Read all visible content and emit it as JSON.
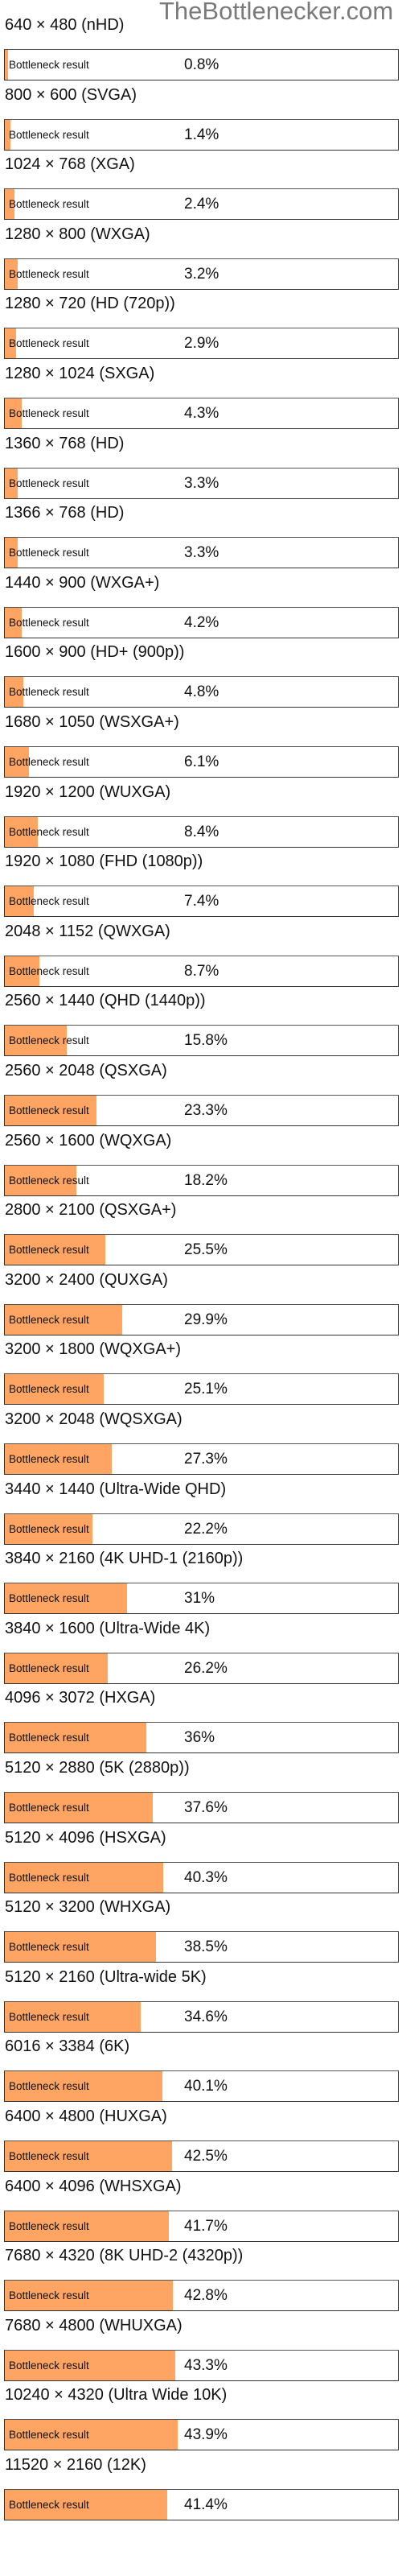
{
  "site": {
    "watermark": "TheBottlenecker.com"
  },
  "colors": {
    "fill": "#ffa563",
    "border": "#333333"
  },
  "chart_data": {
    "type": "bar",
    "title": "",
    "bar_label": "Bottleneck result",
    "xlabel": "",
    "ylabel": "Bottleneck result (%)",
    "ylim": [
      0,
      100
    ],
    "categories": [
      "640 × 480 (nHD)",
      "800 × 600 (SVGA)",
      "1024 × 768 (XGA)",
      "1280 × 800 (WXGA)",
      "1280 × 720 (HD (720p))",
      "1280 × 1024 (SXGA)",
      "1360 × 768 (HD)",
      "1366 × 768 (HD)",
      "1440 × 900 (WXGA+)",
      "1600 × 900 (HD+ (900p))",
      "1680 × 1050 (WSXGA+)",
      "1920 × 1200 (WUXGA)",
      "1920 × 1080 (FHD (1080p))",
      "2048 × 1152 (QWXGA)",
      "2560 × 1440 (QHD (1440p))",
      "2560 × 2048 (QSXGA)",
      "2560 × 1600 (WQXGA)",
      "2800 × 2100 (QSXGA+)",
      "3200 × 2400 (QUXGA)",
      "3200 × 1800 (WQXGA+)",
      "3200 × 2048 (WQSXGA)",
      "3440 × 1440 (Ultra-Wide QHD)",
      "3840 × 2160 (4K UHD-1 (2160p))",
      "3840 × 1600 (Ultra-Wide 4K)",
      "4096 × 3072 (HXGA)",
      "5120 × 2880 (5K (2880p))",
      "5120 × 4096 (HSXGA)",
      "5120 × 3200 (WHXGA)",
      "5120 × 2160 (Ultra-wide 5K)",
      "6016 × 3384 (6K)",
      "6400 × 4800 (HUXGA)",
      "6400 × 4096 (WHSXGA)",
      "7680 × 4320 (8K UHD-2 (4320p))",
      "7680 × 4800 (WHUXGA)",
      "10240 × 4320 (Ultra Wide 10K)",
      "11520 × 2160 (12K)"
    ],
    "values": [
      0.8,
      1.4,
      2.4,
      3.2,
      2.9,
      4.3,
      3.3,
      3.3,
      4.2,
      4.8,
      6.1,
      8.4,
      7.4,
      8.7,
      15.8,
      23.3,
      18.2,
      25.5,
      29.9,
      25.1,
      27.3,
      22.2,
      31,
      26.2,
      36,
      37.6,
      40.3,
      38.5,
      34.6,
      40.1,
      42.5,
      41.7,
      42.8,
      43.3,
      43.9,
      41.4
    ],
    "value_labels": [
      "0.8%",
      "1.4%",
      "2.4%",
      "3.2%",
      "2.9%",
      "4.3%",
      "3.3%",
      "3.3%",
      "4.2%",
      "4.8%",
      "6.1%",
      "8.4%",
      "7.4%",
      "8.7%",
      "15.8%",
      "23.3%",
      "18.2%",
      "25.5%",
      "29.9%",
      "25.1%",
      "27.3%",
      "22.2%",
      "31%",
      "26.2%",
      "36%",
      "37.6%",
      "40.3%",
      "38.5%",
      "34.6%",
      "40.1%",
      "42.5%",
      "41.7%",
      "42.8%",
      "43.3%",
      "43.9%",
      "41.4%"
    ]
  }
}
